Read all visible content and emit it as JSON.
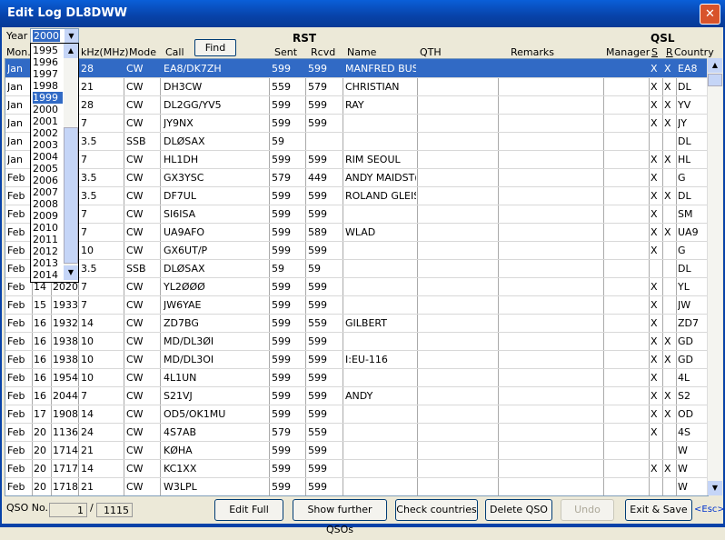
{
  "window": {
    "title": "Edit Log  DL8DWW",
    "close_glyph": "✕"
  },
  "year": {
    "label": "Year",
    "value": "2000",
    "options": [
      "1995",
      "1996",
      "1997",
      "1998",
      "1999",
      "2000",
      "2001",
      "2002",
      "2003",
      "2004",
      "2005",
      "2006",
      "2007",
      "2008",
      "2009",
      "2010",
      "2011",
      "2012",
      "2013",
      "2014"
    ],
    "highlighted": "1999"
  },
  "find_label": "Find",
  "headers": {
    "mon": "Mon.",
    "khz": "kHz(MHz)",
    "mode": "Mode",
    "call": "Call",
    "rst": "RST",
    "sent": "Sent",
    "rcvd": "Rcvd",
    "name": "Name",
    "qth": "QTH",
    "remarks": "Remarks",
    "manager": "Manager",
    "qsl": "QSL",
    "s": "S",
    "r": "R",
    "country": "Country"
  },
  "rows": [
    {
      "mon": "Jan",
      "day": "",
      "time": "",
      "freq": "28",
      "mode": "CW",
      "call": "EA8/DK7ZH",
      "sent": "599",
      "rcvd": "599",
      "name": "MANFRED BUS",
      "s": "X",
      "r": "X",
      "country": "EA8"
    },
    {
      "mon": "Jan",
      "day": "",
      "time": "",
      "freq": "21",
      "mode": "CW",
      "call": "DH3CW",
      "sent": "559",
      "rcvd": "579",
      "name": "CHRISTIAN",
      "s": "X",
      "r": "X",
      "country": "DL"
    },
    {
      "mon": "Jan",
      "day": "",
      "time": "",
      "freq": "28",
      "mode": "CW",
      "call": "DL2GG/YV5",
      "sent": "599",
      "rcvd": "599",
      "name": "RAY",
      "s": "X",
      "r": "X",
      "country": "YV"
    },
    {
      "mon": "Jan",
      "day": "",
      "time": "",
      "freq": "7",
      "mode": "CW",
      "call": "JY9NX",
      "sent": "599",
      "rcvd": "599",
      "name": "",
      "s": "X",
      "r": "X",
      "country": "JY"
    },
    {
      "mon": "Jan",
      "day": "",
      "time": "",
      "freq": "3.5",
      "mode": "SSB",
      "call": "DLØSAX",
      "sent": "59",
      "rcvd": "",
      "name": "",
      "s": "",
      "r": "",
      "country": "DL"
    },
    {
      "mon": "Jan",
      "day": "",
      "time": "",
      "freq": "7",
      "mode": "CW",
      "call": "HL1DH",
      "sent": "599",
      "rcvd": "599",
      "name": "RIM SEOUL",
      "s": "X",
      "r": "X",
      "country": "HL"
    },
    {
      "mon": "Feb",
      "day": "",
      "time": "",
      "freq": "3.5",
      "mode": "CW",
      "call": "GX3YSC",
      "sent": "579",
      "rcvd": "449",
      "name": "ANDY MAIDST(",
      "s": "X",
      "r": "",
      "country": "G"
    },
    {
      "mon": "Feb",
      "day": "",
      "time": "",
      "freq": "3.5",
      "mode": "CW",
      "call": "DF7UL",
      "sent": "599",
      "rcvd": "599",
      "name": "ROLAND GLEIS",
      "s": "X",
      "r": "X",
      "country": "DL"
    },
    {
      "mon": "Feb",
      "day": "",
      "time": "",
      "freq": "7",
      "mode": "CW",
      "call": "SI6ISA",
      "sent": "599",
      "rcvd": "599",
      "name": "",
      "s": "X",
      "r": "",
      "country": "SM"
    },
    {
      "mon": "Feb",
      "day": "",
      "time": "",
      "freq": "7",
      "mode": "CW",
      "call": "UA9AFO",
      "sent": "599",
      "rcvd": "589",
      "name": "WLAD",
      "s": "X",
      "r": "X",
      "country": "UA9"
    },
    {
      "mon": "Feb",
      "day": "",
      "time": "",
      "freq": "10",
      "mode": "CW",
      "call": "GX6UT/P",
      "sent": "599",
      "rcvd": "599",
      "name": "",
      "s": "X",
      "r": "",
      "country": "G"
    },
    {
      "mon": "Feb",
      "day": "",
      "time": "",
      "freq": "3.5",
      "mode": "SSB",
      "call": "DLØSAX",
      "sent": "59",
      "rcvd": "59",
      "name": "",
      "s": "",
      "r": "",
      "country": "DL"
    },
    {
      "mon": "Feb",
      "day": "14",
      "time": "2020",
      "freq": "7",
      "mode": "CW",
      "call": "YL2ØØØ",
      "sent": "599",
      "rcvd": "599",
      "name": "",
      "s": "X",
      "r": "",
      "country": "YL"
    },
    {
      "mon": "Feb",
      "day": "15",
      "time": "1933",
      "freq": "7",
      "mode": "CW",
      "call": "JW6YAE",
      "sent": "599",
      "rcvd": "599",
      "name": "",
      "s": "X",
      "r": "",
      "country": "JW"
    },
    {
      "mon": "Feb",
      "day": "16",
      "time": "1932",
      "freq": "14",
      "mode": "CW",
      "call": "ZD7BG",
      "sent": "599",
      "rcvd": "559",
      "name": "GILBERT",
      "s": "X",
      "r": "",
      "country": "ZD7"
    },
    {
      "mon": "Feb",
      "day": "16",
      "time": "1938",
      "freq": "10",
      "mode": "CW",
      "call": "MD/DL3ØI",
      "sent": "599",
      "rcvd": "599",
      "name": "",
      "s": "X",
      "r": "X",
      "country": "GD"
    },
    {
      "mon": "Feb",
      "day": "16",
      "time": "1938",
      "freq": "10",
      "mode": "CW",
      "call": "MD/DL3OI",
      "sent": "599",
      "rcvd": "599",
      "name": "I:EU-116",
      "s": "X",
      "r": "X",
      "country": "GD"
    },
    {
      "mon": "Feb",
      "day": "16",
      "time": "1954",
      "freq": "10",
      "mode": "CW",
      "call": "4L1UN",
      "sent": "599",
      "rcvd": "599",
      "name": "",
      "s": "X",
      "r": "",
      "country": "4L"
    },
    {
      "mon": "Feb",
      "day": "16",
      "time": "2044",
      "freq": "7",
      "mode": "CW",
      "call": "S21VJ",
      "sent": "599",
      "rcvd": "599",
      "name": "ANDY",
      "s": "X",
      "r": "X",
      "country": "S2"
    },
    {
      "mon": "Feb",
      "day": "17",
      "time": "1908",
      "freq": "14",
      "mode": "CW",
      "call": "OD5/OK1MU",
      "sent": "599",
      "rcvd": "599",
      "name": "",
      "s": "X",
      "r": "X",
      "country": "OD"
    },
    {
      "mon": "Feb",
      "day": "20",
      "time": "1136",
      "freq": "24",
      "mode": "CW",
      "call": "4S7AB",
      "sent": "579",
      "rcvd": "559",
      "name": "",
      "s": "X",
      "r": "",
      "country": "4S"
    },
    {
      "mon": "Feb",
      "day": "20",
      "time": "1714",
      "freq": "21",
      "mode": "CW",
      "call": "KØHA",
      "sent": "599",
      "rcvd": "599",
      "name": "",
      "s": "",
      "r": "",
      "country": "W"
    },
    {
      "mon": "Feb",
      "day": "20",
      "time": "1717",
      "freq": "14",
      "mode": "CW",
      "call": "KC1XX",
      "sent": "599",
      "rcvd": "599",
      "name": "",
      "s": "X",
      "r": "X",
      "country": "W"
    },
    {
      "mon": "Feb",
      "day": "20",
      "time": "1718",
      "freq": "21",
      "mode": "CW",
      "call": "W3LPL",
      "sent": "599",
      "rcvd": "599",
      "name": "",
      "s": "",
      "r": "",
      "country": "W"
    }
  ],
  "footer": {
    "qso_label": "QSO No.",
    "qso_current": "1",
    "qso_sep": "/",
    "qso_total": "1115",
    "edit_full": "Edit Full",
    "show_further": "Show further QSOs",
    "check_countries": "Check countries",
    "delete_qso": "Delete QSO",
    "undo": "Undo",
    "exit_save": "Exit & Save",
    "esc": "<Esc>"
  }
}
